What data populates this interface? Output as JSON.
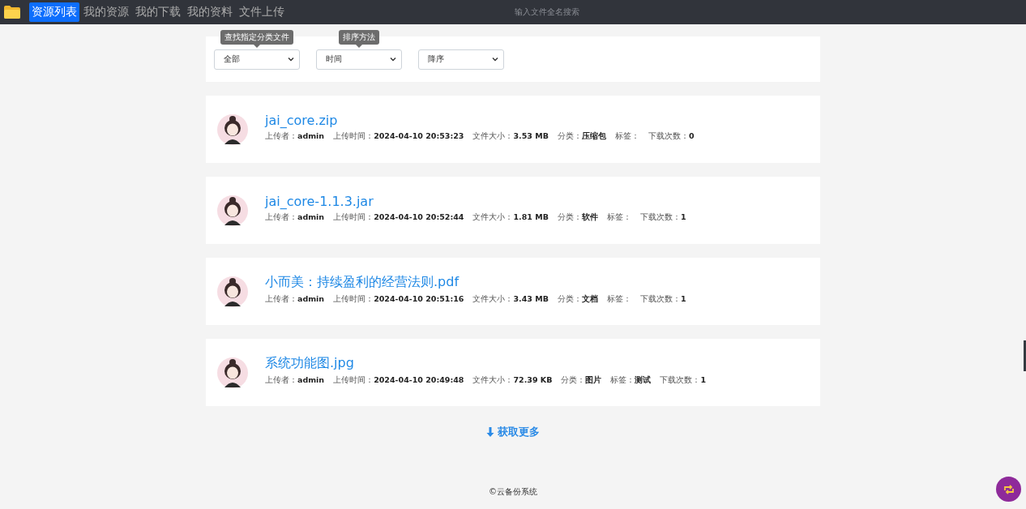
{
  "navbar": {
    "tabs": [
      {
        "label": "资源列表",
        "selected": true
      },
      {
        "label": "我的资源",
        "selected": false
      },
      {
        "label": "我的下载",
        "selected": false
      },
      {
        "label": "我的资料",
        "selected": false
      },
      {
        "label": "文件上传",
        "selected": false
      }
    ],
    "search": {
      "placeholder": "输入文件全名搜索"
    }
  },
  "filters": [
    {
      "value": "全部",
      "tooltip": "查找指定分类文件"
    },
    {
      "value": "时间",
      "tooltip": "排序方法"
    },
    {
      "value": "降序"
    }
  ],
  "files": [
    {
      "name": "jai_core.zip",
      "meta": [
        {
          "label": "上传者：",
          "value": "admin"
        },
        {
          "label": "上传时间：",
          "value": "2024-04-10 20:53:23"
        },
        {
          "label": "文件大小：",
          "value": "3.53 MB"
        },
        {
          "label": "分类：",
          "value": "压缩包"
        },
        {
          "label": "标签："
        },
        {
          "label": "下载次数：",
          "value": "0"
        }
      ]
    },
    {
      "name": "jai_core-1.1.3.jar",
      "meta": [
        {
          "label": "上传者：",
          "value": "admin"
        },
        {
          "label": "上传时间：",
          "value": "2024-04-10 20:52:44"
        },
        {
          "label": "文件大小：",
          "value": "1.81 MB"
        },
        {
          "label": "分类：",
          "value": "软件"
        },
        {
          "label": "标签："
        },
        {
          "label": "下载次数：",
          "value": "1"
        }
      ]
    },
    {
      "name": "小而美：持续盈利的经营法则.pdf",
      "meta": [
        {
          "label": "上传者：",
          "value": "admin"
        },
        {
          "label": "上传时间：",
          "value": "2024-04-10 20:51:16"
        },
        {
          "label": "文件大小：",
          "value": "3.43 MB"
        },
        {
          "label": "分类：",
          "value": "文档"
        },
        {
          "label": "标签："
        },
        {
          "label": "下载次数：",
          "value": "1"
        }
      ]
    },
    {
      "name": "系统功能图.jpg",
      "meta": [
        {
          "label": "上传者：",
          "value": "admin"
        },
        {
          "label": "上传时间：",
          "value": "2024-04-10 20:49:48"
        },
        {
          "label": "文件大小：",
          "value": "72.39 KB"
        },
        {
          "label": "分类：",
          "value": "图片"
        },
        {
          "label": "标签：",
          "value": "测试"
        },
        {
          "label": "下载次数：",
          "value": "1"
        }
      ]
    }
  ],
  "load_more": {
    "label": "获取更多"
  },
  "footer": {
    "text": "©云备份系统"
  }
}
